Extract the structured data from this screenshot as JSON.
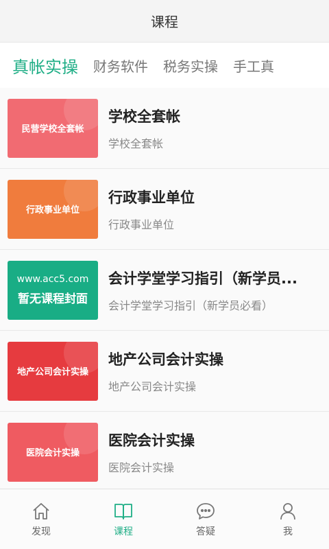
{
  "header": {
    "title": "课程"
  },
  "tabs": [
    {
      "label": "真帐实操",
      "active": true
    },
    {
      "label": "财务软件"
    },
    {
      "label": "税务实操"
    },
    {
      "label": "手工真"
    }
  ],
  "courses": [
    {
      "cover_text": "民营学校全套帐",
      "cover_color": "#f16b72",
      "title": "学校全套帐",
      "subtitle": "学校全套帐"
    },
    {
      "cover_text": "行政事业单位",
      "cover_color": "#f07c3d",
      "title": "行政事业单位",
      "subtitle": "行政事业单位"
    },
    {
      "cover_text_line1": "www.acc5.com",
      "cover_text_line2": "暂无课程封面",
      "cover_color": "#19ad85",
      "title": "会计学堂学习指引（新学员...",
      "subtitle": "会计学堂学习指引（新学员必看）"
    },
    {
      "cover_text": "地产公司会计实操",
      "cover_color": "#e63b3f",
      "title": "地产公司会计实操",
      "subtitle": "地产公司会计实操"
    },
    {
      "cover_text": "医院会计实操",
      "cover_color": "#ef5b61",
      "title": "医院会计实操",
      "subtitle": "医院会计实操"
    }
  ],
  "tabbar": [
    {
      "label": "发现",
      "icon": "home-icon"
    },
    {
      "label": "课程",
      "icon": "book-icon",
      "active": true
    },
    {
      "label": "答疑",
      "icon": "chat-bubble-icon"
    },
    {
      "label": "我",
      "icon": "person-icon"
    }
  ],
  "colors": {
    "accent": "#1fae86"
  }
}
